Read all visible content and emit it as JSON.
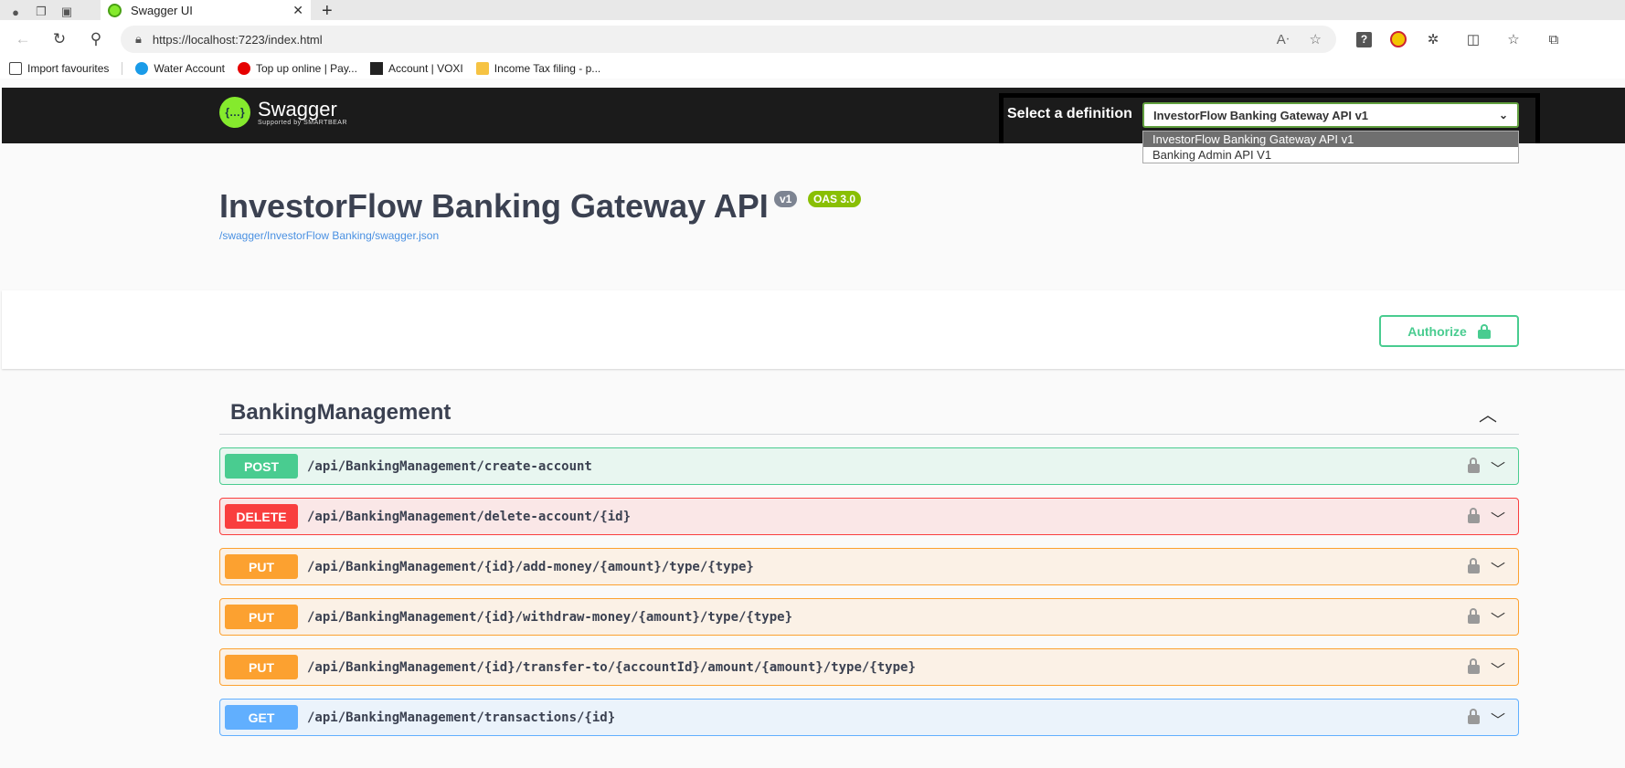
{
  "browser": {
    "tab_title": "Swagger UI",
    "tab_close": "✕",
    "new_tab": "+",
    "url": "https://localhost:7223/index.html",
    "bookmarks": [
      "Import favourites",
      "Water Account",
      "Top up online | Pay...",
      "Account | VOXI",
      "Income Tax filing - p..."
    ]
  },
  "swagger": {
    "logo_text": "Swagger",
    "logo_sub": "Supported by SMARTBEAR",
    "definition_label": "Select a definition",
    "definition_selected": "InvestorFlow Banking Gateway API v1",
    "definition_options": [
      "InvestorFlow Banking Gateway API v1",
      "Banking Admin API V1"
    ],
    "title": "InvestorFlow Banking Gateway API",
    "version_badge": "v1",
    "oas_badge": "OAS 3.0",
    "spec_link": "/swagger/InvestorFlow Banking/swagger.json",
    "authorize_label": "Authorize",
    "tag": "BankingManagement",
    "operations": [
      {
        "method": "POST",
        "path": "/api/BankingManagement/create-account"
      },
      {
        "method": "DELETE",
        "path": "/api/BankingManagement/delete-account/{id}"
      },
      {
        "method": "PUT",
        "path": "/api/BankingManagement/{id}/add-money/{amount}/type/{type}"
      },
      {
        "method": "PUT",
        "path": "/api/BankingManagement/{id}/withdraw-money/{amount}/type/{type}"
      },
      {
        "method": "PUT",
        "path": "/api/BankingManagement/{id}/transfer-to/{accountId}/amount/{amount}/type/{type}"
      },
      {
        "method": "GET",
        "path": "/api/BankingManagement/transactions/{id}"
      }
    ]
  }
}
